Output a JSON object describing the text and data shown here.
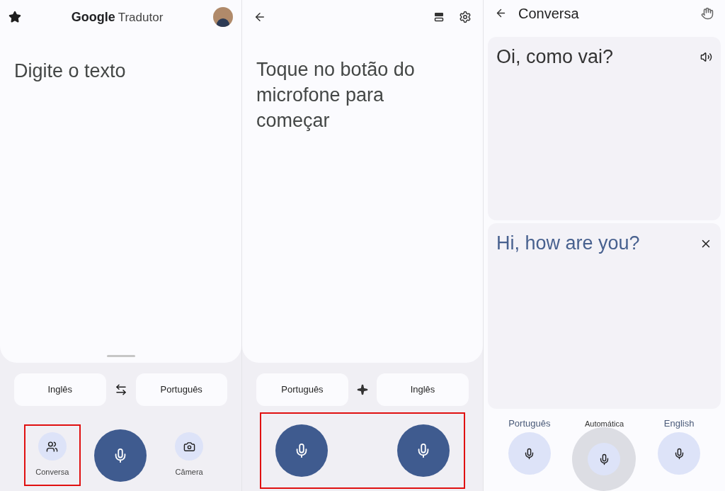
{
  "home": {
    "logo": "Google",
    "title": "Tradutor",
    "input_placeholder": "Digite o texto",
    "source_language": "Inglês",
    "target_language": "Português",
    "actions": [
      {
        "kind": "conversation",
        "label": "Conversa",
        "highlighted": true
      },
      {
        "kind": "mic"
      },
      {
        "kind": "camera",
        "label": "Câmera",
        "highlighted": false
      }
    ]
  },
  "voice": {
    "prompt": "Toque no botão do microfone para começar",
    "source_language": "Português",
    "target_language": "Inglês",
    "mics_highlighted": true
  },
  "conversation": {
    "title": "Conversa",
    "source_text": "Oi, como vai?",
    "translated_text": "Hi, how are you?",
    "languages": [
      {
        "kind": "language",
        "label": "Português",
        "selected": false
      },
      {
        "kind": "auto",
        "label": "Automática",
        "selected": true
      },
      {
        "kind": "language",
        "label": "English",
        "selected": false
      }
    ]
  }
}
